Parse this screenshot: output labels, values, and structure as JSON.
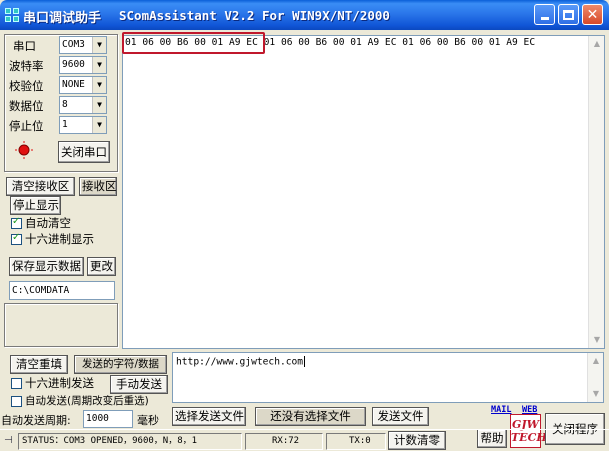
{
  "title": {
    "cn": "串口调试助手",
    "en": "SComAssistant V2.2 For WIN9X/NT/2000"
  },
  "settings": {
    "port_label": "串口",
    "port_value": "COM3",
    "baud_label": "波特率",
    "baud_value": "9600",
    "parity_label": "校验位",
    "parity_value": "NONE",
    "databits_label": "数据位",
    "databits_value": "8",
    "stopbits_label": "停止位",
    "stopbits_value": "1",
    "close_port_label": "关闭串口"
  },
  "receive": {
    "clear_label": "清空接收区",
    "area_label": "接收区",
    "stop_display_label": "停止显示",
    "auto_clear_label": "自动清空",
    "auto_clear_checked": true,
    "hex_display_label": "十六进制显示",
    "hex_display_checked": true,
    "save_label": "保存显示数据",
    "change_label": "更改",
    "path": "C:\\COMDATA",
    "content": "01 06 00 B6 00 01 A9 EC 01 06 00 B6 00 01 A9 EC 01 06 00 B6 00 01 A9 EC"
  },
  "send": {
    "clear_label": "清空重填",
    "send_area_label": "发送的字符/数据",
    "hex_send_label": "十六进制发送",
    "manual_send_label": "手动发送",
    "auto_send_label": "自动发送(周期改变后重选)",
    "period_label": "自动发送周期:",
    "period_value": "1000",
    "period_unit": "毫秒",
    "choose_file_label": "选择发送文件",
    "file_status": "还没有选择文件",
    "send_file_label": "发送文件",
    "content": "http://www.gjwtech.com"
  },
  "links": {
    "mail": "MAIL",
    "web": "WEB",
    "help": "帮助",
    "logo_line1": "GJW",
    "logo_line2": "TECH",
    "close_program": "关闭程序"
  },
  "status": {
    "status_text": "STATUS：COM3 OPENED，9600，N，8，1",
    "rx": "RX:72",
    "tx": "TX:0",
    "reset_counter": "计数清零"
  },
  "colors": {
    "titlebar": "#2a76ea",
    "highlight_box": "#c0182c",
    "window_bg": "#ece9d8",
    "port_indicator": "#e01010"
  },
  "icons": {
    "app": "app-icon",
    "minimize": "minimize-icon",
    "maximize": "maximize-icon",
    "close": "close-icon",
    "port_indicator": "port-status-led-icon",
    "status_grip": "status-grip-icon"
  }
}
